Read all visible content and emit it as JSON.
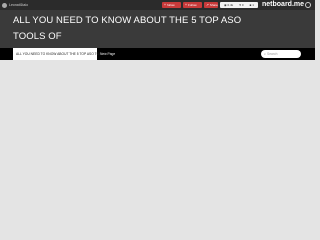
{
  "topbar": {
    "user_name": "Leonatl1taio",
    "follow_label": "follow",
    "follow2_label": "Follow",
    "share_label": "Share",
    "stats": {
      "views": "0.4k",
      "likes": "0",
      "comments": "1"
    },
    "brand": "netboard.me",
    "icons": {
      "user": "avatar-icon",
      "follow": "plus-icon",
      "share": "share-icon",
      "views": "eye-icon",
      "likes": "heart-icon",
      "comments": "comment-icon",
      "power": "power-icon"
    }
  },
  "hero": {
    "title": "ALL YOU NEED TO KNOW ABOUT THE 5 TOP ASO TOOLS OF"
  },
  "nav": {
    "current_tab": "ALL YOU NEED TO KNOW ABOUT THE 5 TOP ASO TOOLS OF",
    "next_tab": "New Page",
    "search_placeholder": "Search"
  },
  "colors": {
    "topbar": "#2b2b2b",
    "hero": "#3a3a3a",
    "navbar": "#000000",
    "accent_button": "#c83a3a",
    "content": "#e4e4e4"
  }
}
